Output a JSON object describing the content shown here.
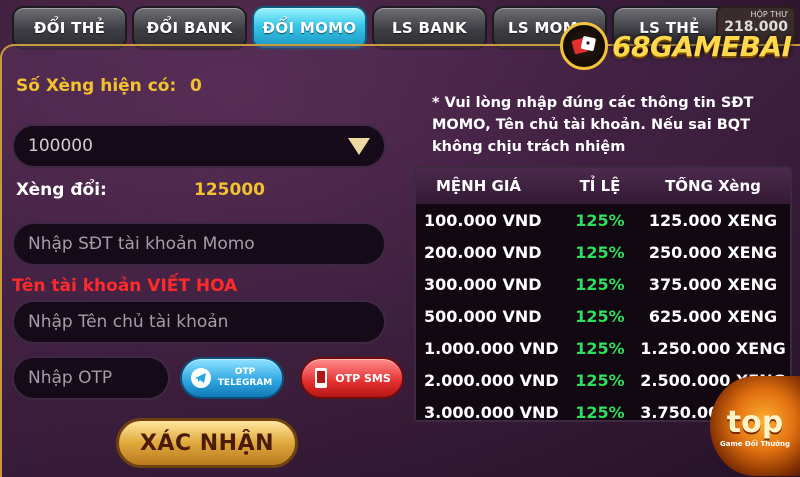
{
  "tabs": [
    {
      "label": "ĐỔI THẺ",
      "active": false
    },
    {
      "label": "ĐỔI BANK",
      "active": false
    },
    {
      "label": "ĐỔI MOMO",
      "active": true
    },
    {
      "label": "LS BANK",
      "active": false
    },
    {
      "label": "LS MOMO",
      "active": false
    },
    {
      "label": "LS THẺ",
      "active": false
    }
  ],
  "mailbox": {
    "label": "HỘP THƯ",
    "amount": "218.000"
  },
  "logo": {
    "text": "68GAMEBAI"
  },
  "corner_logo": {
    "text": "top",
    "subtitle": "Game Đổi Thưởng"
  },
  "form": {
    "balance_label": "Số Xèng hiện có:",
    "balance_value": "0",
    "amount_select_value": "100000",
    "receive_label": "Xèng đổi:",
    "receive_value": "125000",
    "phone_placeholder": "Nhập SĐT tài khoản Momo",
    "account_hint": "Tên tài khoản VIẾT HOA",
    "name_placeholder": "Nhập Tên chủ tài khoản",
    "otp_placeholder": "Nhập OTP",
    "otp_telegram_label": "OTP TELEGRAM",
    "otp_sms_label": "OTP SMS",
    "confirm_label": "XÁC NHẬN"
  },
  "note": "* Vui lòng nhập đúng các thông tin SĐT MOMO, Tên chủ tài khoản. Nếu sai BQT không chịu trách nhiệm",
  "table": {
    "headers": [
      "MỆNH GIÁ",
      "TỈ LỆ",
      "TỔNG Xèng"
    ],
    "rows": [
      [
        "100.000 VND",
        "125%",
        "125.000 XENG"
      ],
      [
        "200.000 VND",
        "125%",
        "250.000 XENG"
      ],
      [
        "300.000 VND",
        "125%",
        "375.000 XENG"
      ],
      [
        "500.000 VND",
        "125%",
        "625.000 XENG"
      ],
      [
        "1.000.000 VND",
        "125%",
        "1.250.000 XENG"
      ],
      [
        "2.000.000 VND",
        "125%",
        "2.500.000 XENG"
      ],
      [
        "3.000.000 VND",
        "125%",
        "3.750.000 XENG"
      ]
    ]
  },
  "colors": {
    "accent_gold": "#f2c12e",
    "active_tab": "#37c6e8",
    "percent_green": "#2ee05a",
    "hint_red": "#ff2a2a"
  }
}
